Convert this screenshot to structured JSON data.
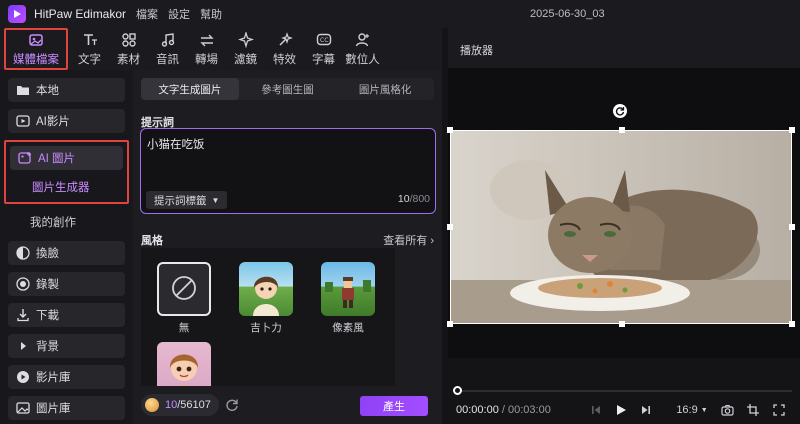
{
  "app": {
    "name": "HitPaw Edimakor",
    "menu": [
      "檔案",
      "設定",
      "幫助"
    ],
    "project_title": "2025-06-30_03"
  },
  "toolbar": {
    "items": [
      {
        "label": "媒體檔案",
        "icon": "image-icon",
        "active": true
      },
      {
        "label": "文字",
        "icon": "text-icon"
      },
      {
        "label": "素材",
        "icon": "assets-icon"
      },
      {
        "label": "音訊",
        "icon": "music-icon"
      },
      {
        "label": "轉場",
        "icon": "transition-icon"
      },
      {
        "label": "濾鏡",
        "icon": "filter-icon"
      },
      {
        "label": "特效",
        "icon": "effects-icon"
      },
      {
        "label": "字幕",
        "icon": "caption-icon"
      },
      {
        "label": "數位人",
        "icon": "avatar-icon"
      }
    ]
  },
  "sidebar": {
    "local": "本地",
    "ai_video": "AI影片",
    "ai_image": "AI 圖片",
    "image_generator": "圖片生成器",
    "my_creations": "我的創作",
    "face_swap": "換臉",
    "record": "錄製",
    "download": "下載",
    "background": "背景",
    "video_library": "影片庫",
    "image_library": "圖片庫"
  },
  "panel": {
    "tabs": [
      "文字生成圖片",
      "參考圖生圖",
      "圖片風格化"
    ],
    "prompt_label": "提示詞",
    "prompt_value": "小猫在吃饭",
    "prompt_tag_button": "提示詞標籤",
    "char_count": "10",
    "char_limit": "/800",
    "style_label": "風格",
    "view_all": "查看所有",
    "styles": [
      "無",
      "吉卜力",
      "像素風"
    ],
    "credits_current": "10",
    "credits_total": "/56107",
    "generate": "產生"
  },
  "player": {
    "title": "播放器",
    "current_time": "00:00:00",
    "separator": " / ",
    "duration": "00:03:00",
    "aspect_ratio": "16:9",
    "progress": 0
  },
  "colors": {
    "accent": "#a34dff",
    "highlight_border": "#e0443e",
    "active_text": "#c98bff"
  }
}
